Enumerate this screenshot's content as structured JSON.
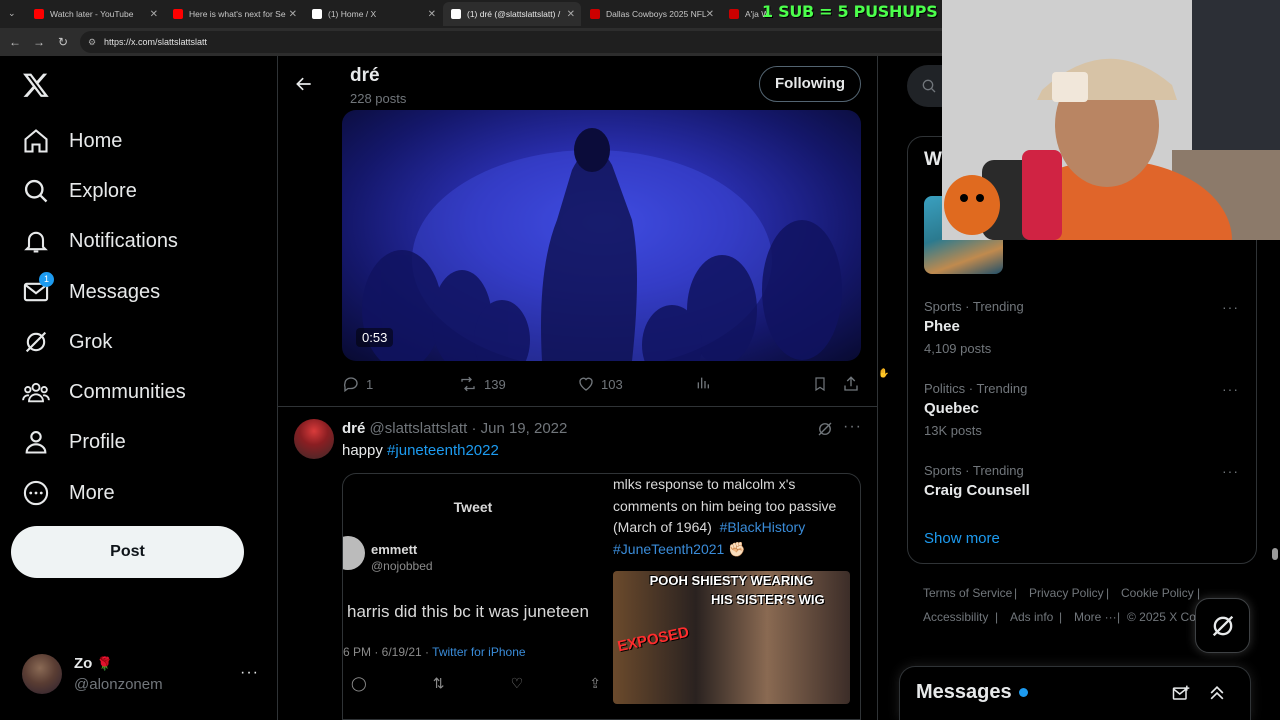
{
  "browser": {
    "tabs": [
      {
        "title": "Watch later - YouTube",
        "favicon_color": "#ff0000"
      },
      {
        "title": "Here is what's next for Se",
        "favicon_color": "#ff0000"
      },
      {
        "title": "(1) Home / X",
        "favicon_color": "#ffffff"
      },
      {
        "title": "(1) dré (@slattslattslatt) /",
        "favicon_color": "#ffffff",
        "active": true
      },
      {
        "title": "Dallas Cowboys 2025 NFL",
        "favicon_color": "#cc0000"
      },
      {
        "title": "A'ja Wi",
        "favicon_color": "#cc0000"
      }
    ],
    "url": "https://x.com/slattslattslatt"
  },
  "stream_overlay": {
    "banner": "1 SUB = 5 PUSHUPS"
  },
  "sidebar": {
    "logo": "X",
    "items": [
      {
        "label": "Home",
        "icon": "home-icon"
      },
      {
        "label": "Explore",
        "icon": "search-icon"
      },
      {
        "label": "Notifications",
        "icon": "bell-icon"
      },
      {
        "label": "Messages",
        "icon": "envelope-icon",
        "badge": "1"
      },
      {
        "label": "Grok",
        "icon": "grok-icon"
      },
      {
        "label": "Communities",
        "icon": "communities-icon"
      },
      {
        "label": "Profile",
        "icon": "person-icon"
      },
      {
        "label": "More",
        "icon": "more-circle-icon"
      }
    ],
    "post_label": "Post",
    "account": {
      "name": "Zo",
      "emoji": "🌹",
      "handle": "@alonzonem"
    }
  },
  "header": {
    "name": "dré",
    "posts_count": "228 posts",
    "follow_label": "Following"
  },
  "tweet1": {
    "video_duration": "0:53",
    "replies": "1",
    "reposts": "139",
    "likes": "103"
  },
  "tweet2": {
    "name": "dré",
    "handle": "@slattslattslatt",
    "date": "· Jun 19, 2022",
    "text_prefix": "happy ",
    "hashtag": "#juneteenth2022",
    "quote_left": {
      "header": "Tweet",
      "name": "emmett",
      "handle": "@nojobbed",
      "text": "harris did this bc it was juneteen",
      "meta_time": "6 PM · 6/19/21 ·",
      "meta_client": "Twitter for iPhone"
    },
    "quote_right": {
      "line1": "mlks response to malcolm x's",
      "line2": "comments on him being too passive",
      "line3": "(March of 1964)",
      "tag1": "#BlackHistory",
      "tag2": "#JuneTeenth2021",
      "emoji": "✊🏻",
      "thumb_top": "POOH SHIESTY WEARING",
      "thumb_bottom": "HIS SISTER'S WIG",
      "thumb_stamp": "EXPOSED"
    }
  },
  "right": {
    "card_title_partial": "W",
    "trends": [
      {
        "meta": "Sports · Trending",
        "name": "Phee",
        "count": "4,109 posts"
      },
      {
        "meta": "Politics · Trending",
        "name": "Quebec",
        "count": "13K posts"
      },
      {
        "meta": "Sports · Trending",
        "name": "Craig Counsell",
        "count": ""
      }
    ],
    "show_more": "Show more",
    "footer": [
      "Terms of Service",
      "Privacy Policy",
      "Cookie Policy",
      "Accessibility",
      "Ads info",
      "More ···",
      "© 2025 X Cor"
    ],
    "messages_title": "Messages"
  },
  "colors": {
    "accent": "#1d9bf0",
    "text": "#e7e9ea",
    "muted": "#71767b",
    "border": "#2f3336",
    "banner": "#4cff4c"
  }
}
